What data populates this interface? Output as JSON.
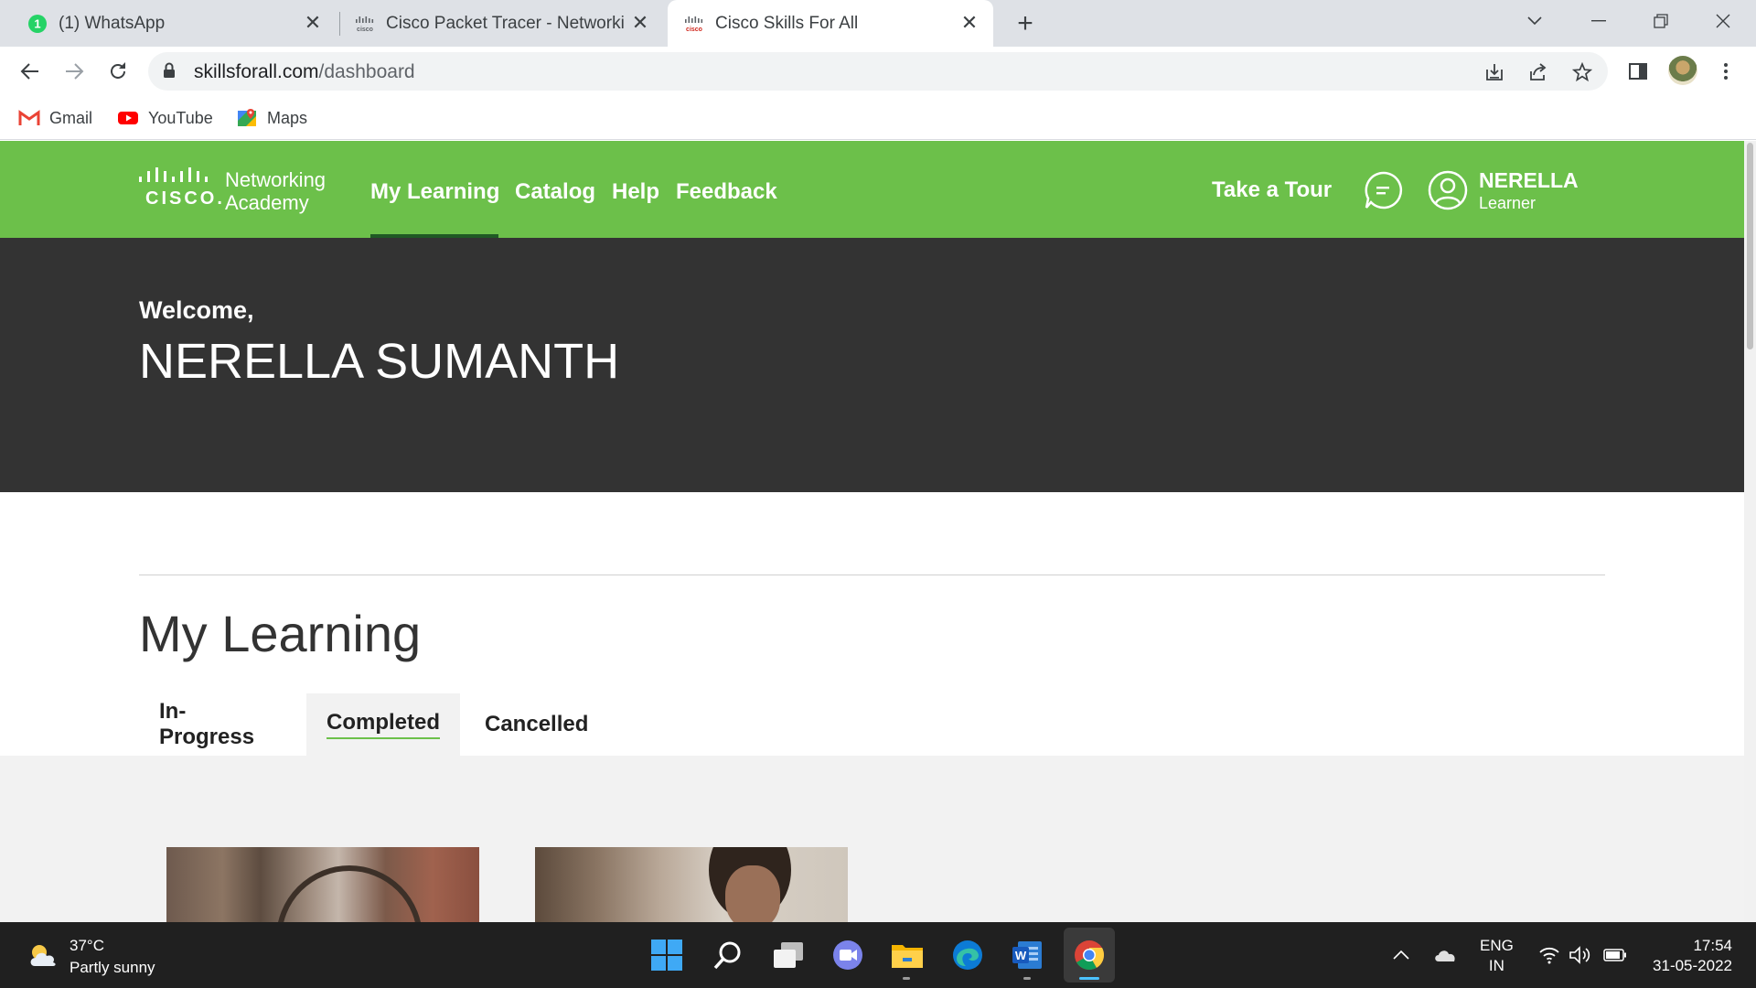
{
  "browser": {
    "tabs": [
      {
        "title": "(1) WhatsApp",
        "badge": "1",
        "active": false
      },
      {
        "title": "Cisco Packet Tracer - Networking",
        "active": false
      },
      {
        "title": "Cisco Skills For All",
        "active": true
      }
    ],
    "url_host": "skillsforall.com",
    "url_path": "/dashboard",
    "bookmarks": [
      {
        "label": "Gmail",
        "icon": "gmail-icon"
      },
      {
        "label": "YouTube",
        "icon": "youtube-icon"
      },
      {
        "label": "Maps",
        "icon": "maps-icon"
      }
    ]
  },
  "site": {
    "logo_word": "CISCO.",
    "logo_line1": "Networking",
    "logo_line2": "Academy",
    "nav": [
      "My Learning",
      "Catalog",
      "Help",
      "Feedback"
    ],
    "active_nav": "My Learning",
    "take_tour": "Take a Tour",
    "user_name": "NERELLA",
    "user_role": "Learner",
    "brand_color": "#6cc04a",
    "hero_color": "#333333"
  },
  "hero": {
    "welcome": "Welcome,",
    "full_name": "NERELLA SUMANTH"
  },
  "learning": {
    "title": "My Learning",
    "tabs": [
      "In-Progress",
      "Completed",
      "Cancelled"
    ],
    "selected_tab": "Completed"
  },
  "taskbar": {
    "temperature": "37°C",
    "condition": "Partly sunny",
    "lang_line1": "ENG",
    "lang_line2": "IN",
    "time": "17:54",
    "date": "31-05-2022"
  }
}
